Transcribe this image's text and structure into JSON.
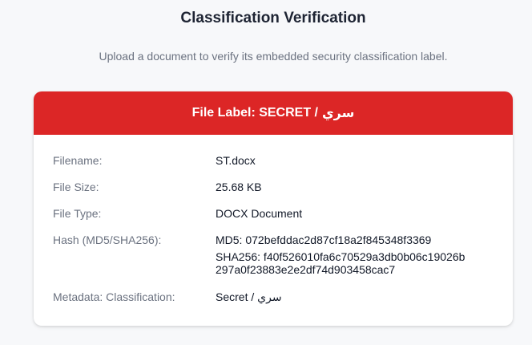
{
  "page": {
    "title": "Classification Verification",
    "subtitle": "Upload a document to verify its embedded security classification label."
  },
  "card": {
    "header_prefix": "File Label: SECRET /",
    "header_arabic": "سري",
    "header_color": "#dc2626",
    "rows": {
      "filename": {
        "label": "Filename:",
        "value": "ST.docx"
      },
      "file_size": {
        "label": "File Size:",
        "value": "25.68 KB"
      },
      "file_type": {
        "label": "File Type:",
        "value": "DOCX Document"
      },
      "hash": {
        "label": "Hash (MD5/SHA256):",
        "md5": "MD5: 072befddac2d87cf18a2f845348f3369",
        "sha256_line1": "SHA256: f40f526010fa6c70529a3db0b06c19026b",
        "sha256_line2": "297a0f23883e2e2df74d903458cac7"
      },
      "classification": {
        "label": "Metadata: Classification:",
        "value": "Secret / سري"
      }
    }
  }
}
